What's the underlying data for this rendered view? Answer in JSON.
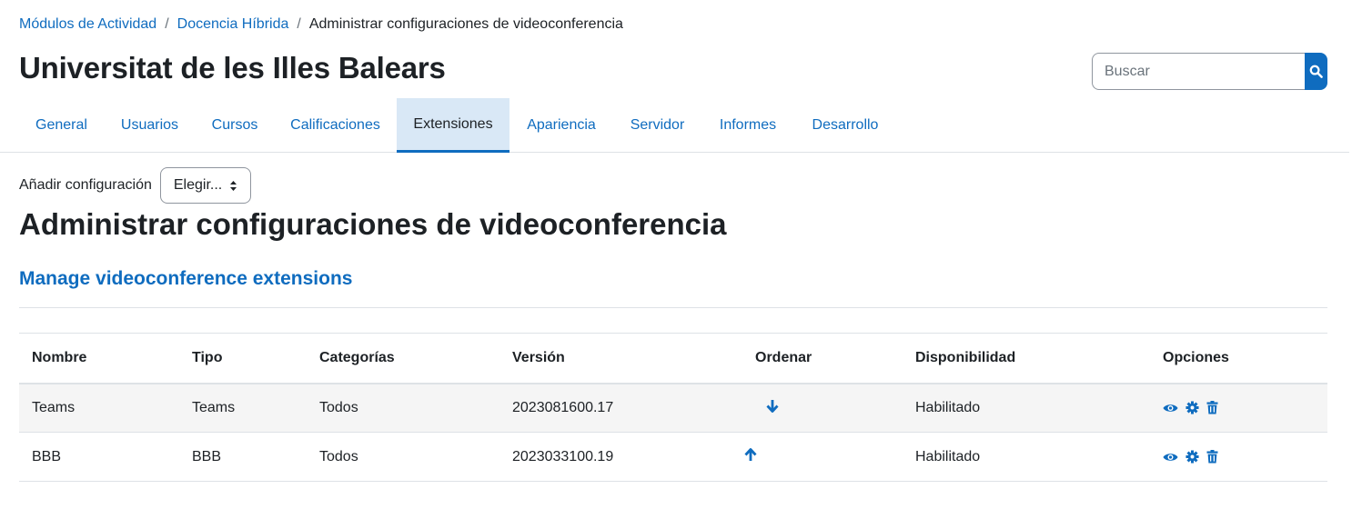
{
  "breadcrumb": {
    "items": [
      "Módulos de Actividad",
      "Docencia Híbrida"
    ],
    "current": "Administrar configuraciones de videoconferencia",
    "separator": "/"
  },
  "header": {
    "title": "Universitat de les Illes Balears"
  },
  "search": {
    "placeholder": "Buscar",
    "icon": "search-icon"
  },
  "tabs": [
    {
      "label": "General"
    },
    {
      "label": "Usuarios"
    },
    {
      "label": "Cursos"
    },
    {
      "label": "Calificaciones"
    },
    {
      "label": "Extensiones",
      "active": true
    },
    {
      "label": "Apariencia"
    },
    {
      "label": "Servidor"
    },
    {
      "label": "Informes"
    },
    {
      "label": "Desarrollo"
    }
  ],
  "add_config": {
    "label": "Añadir configuración",
    "select_value": "Elegir..."
  },
  "main": {
    "heading": "Administrar configuraciones de videoconferencia",
    "subheading": "Manage videoconference extensions"
  },
  "table": {
    "columns": [
      "Nombre",
      "Tipo",
      "Categorías",
      "Versión",
      "Ordenar",
      "Disponibilidad",
      "Opciones"
    ],
    "rows": [
      {
        "name": "Teams",
        "type": "Teams",
        "categories": "Todos",
        "version": "2023081600.17",
        "order": "arrow-down-icon",
        "availability": "Habilitado"
      },
      {
        "name": "BBB",
        "type": "BBB",
        "categories": "Todos",
        "version": "2023033100.19",
        "order": "arrow-up-icon",
        "availability": "Habilitado"
      }
    ]
  },
  "colors": {
    "accent": "#0f6cbf",
    "active_tab_bg": "#d9e8f6",
    "text": "#1d2125",
    "stripe": "#f5f5f5"
  }
}
